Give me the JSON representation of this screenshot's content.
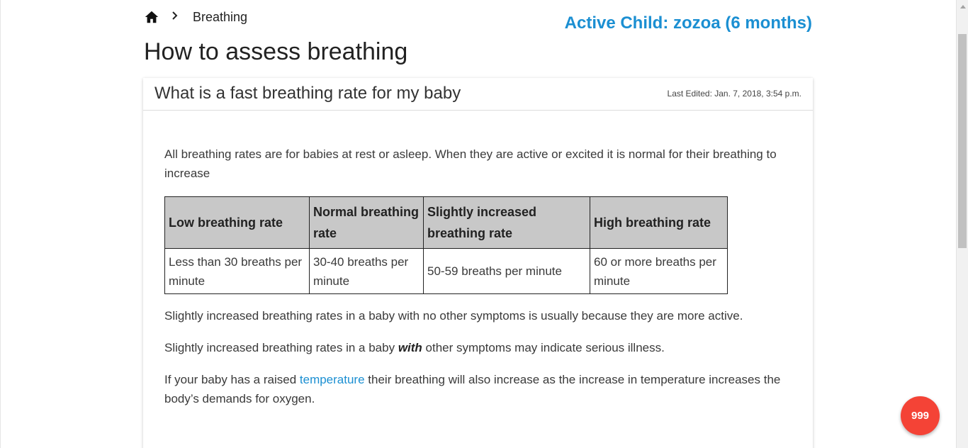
{
  "header": {
    "breadcrumb_current": "Breathing",
    "active_child": "Active Child: zozoa (6 months)"
  },
  "page_title": "How to assess breathing",
  "card": {
    "title": "What is a fast breathing rate for my baby",
    "last_edited": "Last Edited: Jan. 7, 2018, 3:54 p.m.",
    "intro": "All breathing rates are for babies at rest or asleep. When they are active or excited it is normal for their breathing to increase",
    "table": {
      "headers": [
        "Low breathing rate",
        "Normal breathing rate",
        "Slightly increased breathing rate",
        "High breathing rate"
      ],
      "row": [
        "Less than 30 breaths per minute",
        "30-40 breaths per minute",
        "50-59 breaths per minute",
        "60 or more breaths per minute"
      ]
    },
    "para1": "Slightly increased breathing rates in a baby with no other symptoms is usually because they are more active.",
    "para2_before": "Slightly increased breathing rates in a baby ",
    "para2_emph": "with",
    "para2_after": " other symptoms may indicate serious illness.",
    "para3_before": "If your baby has a raised ",
    "para3_link": "temperature",
    "para3_after": " their breathing will also increase as the increase in temperature increases the body’s demands for oxygen."
  },
  "emergency_button": "999",
  "icons": {
    "home": "home-icon",
    "chevron": "chevron-right-icon"
  },
  "colors": {
    "accent": "#1b8fd2",
    "emergency": "#f44336",
    "table_header_bg": "#c8c8c8"
  }
}
